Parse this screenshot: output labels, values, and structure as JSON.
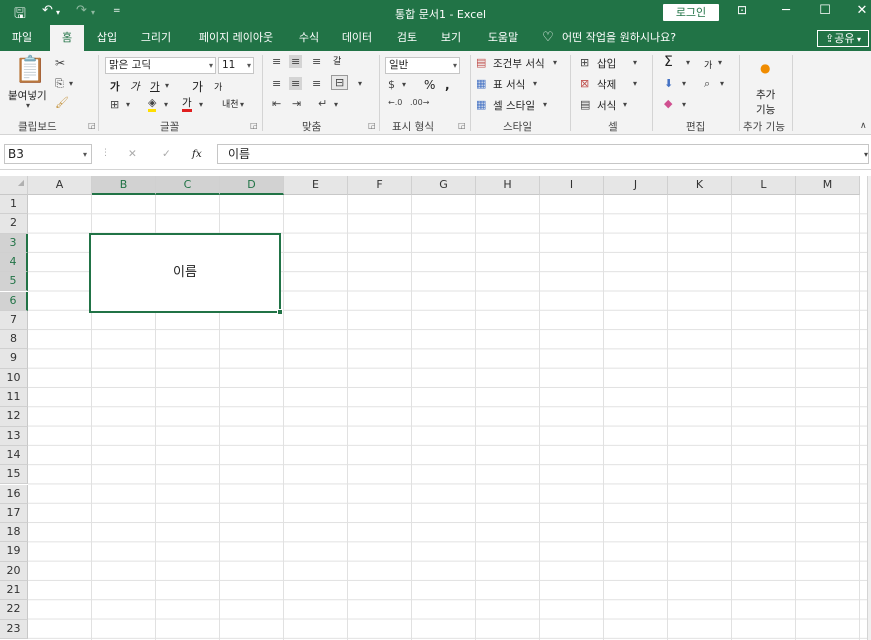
{
  "title_bar": {
    "save_icon": "save-icon",
    "undo_icon": "undo-icon",
    "redo_icon": "redo-icon",
    "quick_access_icon": "customize-quick-access-icon",
    "document_title": "통합 문서1  -  Excel",
    "login_label": "로그인",
    "ribbon_display_icon": "ribbon-display-options-icon",
    "minimize": "minimize-icon",
    "maximize": "maximize-icon",
    "close": "close-icon"
  },
  "tabs": [
    {
      "label": "파일",
      "active": false
    },
    {
      "label": "홈",
      "active": true
    },
    {
      "label": "삽입",
      "active": false
    },
    {
      "label": "그리기",
      "active": false
    },
    {
      "label": "페이지 레이아웃",
      "active": false
    },
    {
      "label": "수식",
      "active": false
    },
    {
      "label": "데이터",
      "active": false
    },
    {
      "label": "검토",
      "active": false
    },
    {
      "label": "보기",
      "active": false
    },
    {
      "label": "도움말",
      "active": false
    }
  ],
  "tell_me": "어떤 작업을 원하시나요?",
  "share_label": "공유",
  "ribbon": {
    "clipboard": {
      "paste_label": "붙여넣기",
      "group_label": "클립보드"
    },
    "font": {
      "font_name": "맑은 고딕",
      "font_size": "11",
      "bold": "가",
      "italic": "가",
      "underline": "가",
      "grow": "가",
      "shrink": "가",
      "font_color": "가",
      "phonetic": "내천",
      "group_label": "글꼴"
    },
    "alignment": {
      "wrap": "갈",
      "group_label": "맞춤"
    },
    "number": {
      "format": "일반",
      "percent": "%",
      "comma": ",",
      "group_label": "표시 형식"
    },
    "styles": {
      "conditional": "조건부 서식",
      "table": "표 서식",
      "cell_styles": "셀 스타일",
      "group_label": "스타일"
    },
    "cells": {
      "insert": "삽입",
      "delete": "삭제",
      "format": "서식",
      "group_label": "셀"
    },
    "editing": {
      "sigma": "Σ",
      "sort": "가",
      "group_label": "편집"
    },
    "addins": {
      "button_label_1": "추가",
      "button_label_2": "기능",
      "group_label": "추가 기능"
    }
  },
  "formula_bar": {
    "name_box": "B3",
    "cancel": "✕",
    "enter": "✓",
    "fx": "fx",
    "content": "이름"
  },
  "columns": [
    "A",
    "B",
    "C",
    "D",
    "E",
    "F",
    "G",
    "H",
    "I",
    "J",
    "K",
    "L",
    "M"
  ],
  "selected_columns": [
    "B",
    "C",
    "D"
  ],
  "rows": [
    "1",
    "2",
    "3",
    "4",
    "5",
    "6",
    "7",
    "8",
    "9",
    "10",
    "11",
    "12",
    "13",
    "14",
    "15",
    "16",
    "17",
    "18",
    "19",
    "20",
    "21",
    "22",
    "23"
  ],
  "selected_rows": [
    "3",
    "4",
    "5",
    "6"
  ],
  "cells": {
    "merged_B3_D6": "이름"
  },
  "accent_color": "#217346"
}
